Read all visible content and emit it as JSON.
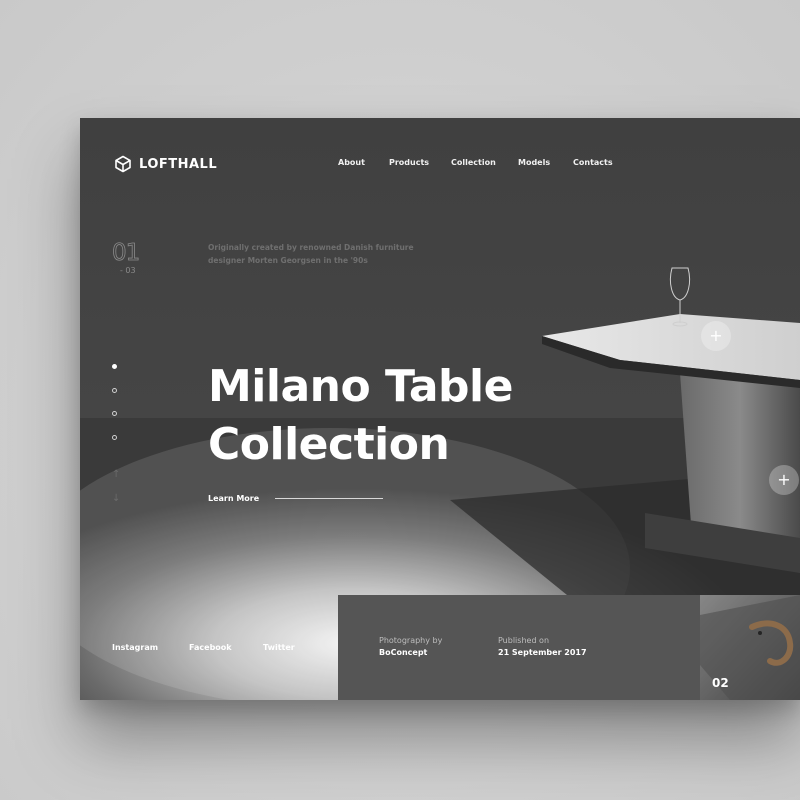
{
  "brand": {
    "name": "LOFTHALL",
    "logo_icon": "cube-icon"
  },
  "nav": {
    "items": [
      "About",
      "Products",
      "Collection",
      "Models",
      "Contacts"
    ]
  },
  "slider": {
    "current": "01",
    "total": "- 03",
    "intro": "Originally created by renowned Danish furniture designer Morten Georgsen in the '90s"
  },
  "hero": {
    "title_line1": "Milano Table",
    "title_line2": "Collection",
    "cta_label": "Learn More"
  },
  "arrows": {
    "up": "↑",
    "down": "↓"
  },
  "hotspots": {
    "symbol": "+"
  },
  "social": {
    "links": [
      "Instagram",
      "Facebook",
      "Twitter"
    ]
  },
  "credits": {
    "photo_label": "Photography by",
    "photo_value": "BoConcept",
    "published_label": "Published on",
    "published_value": "21 September 2017"
  },
  "next_slide": {
    "number": "02"
  },
  "colors": {
    "accent": "#ffffff",
    "panel": "#555555",
    "muted_text": "#6f6f6f"
  }
}
